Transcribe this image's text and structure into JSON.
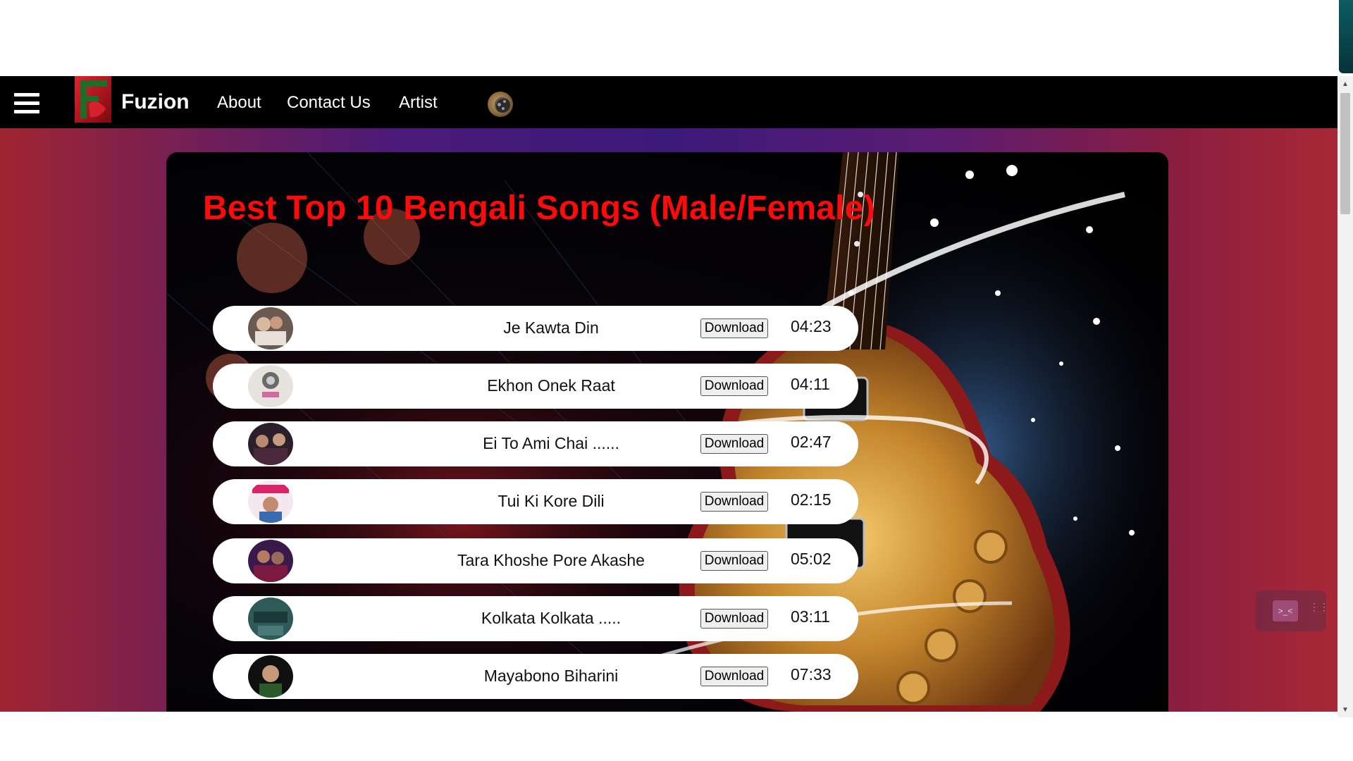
{
  "app": {
    "brand": "Fuzion"
  },
  "nav": {
    "menu_icon": "hamburger-menu-icon",
    "links": [
      {
        "label": "About"
      },
      {
        "label": "Contact Us"
      },
      {
        "label": "Artist"
      }
    ],
    "theme_toggle_icon": "moon-icon"
  },
  "main": {
    "title": "Best Top 10 Bengali Songs (Male/Female)",
    "songs": [
      {
        "title": "Je Kawta Din",
        "download_label": "Download",
        "duration": "04:23"
      },
      {
        "title": "Ekhon Onek Raat",
        "download_label": "Download",
        "duration": "04:11"
      },
      {
        "title": "Ei To Ami Chai ......",
        "download_label": "Download",
        "duration": "02:47"
      },
      {
        "title": "Tui Ki Kore Dili",
        "download_label": "Download",
        "duration": "02:15"
      },
      {
        "title": "Tara Khoshe Pore Akashe",
        "download_label": "Download",
        "duration": "05:02"
      },
      {
        "title": "Kolkata Kolkata .....",
        "download_label": "Download",
        "duration": "03:11"
      },
      {
        "title": "Mayabono Biharini",
        "download_label": "Download",
        "duration": "07:33"
      }
    ]
  },
  "colors": {
    "title": "#ff0a0a",
    "navbar": "#000000",
    "row": "#ffffff"
  }
}
